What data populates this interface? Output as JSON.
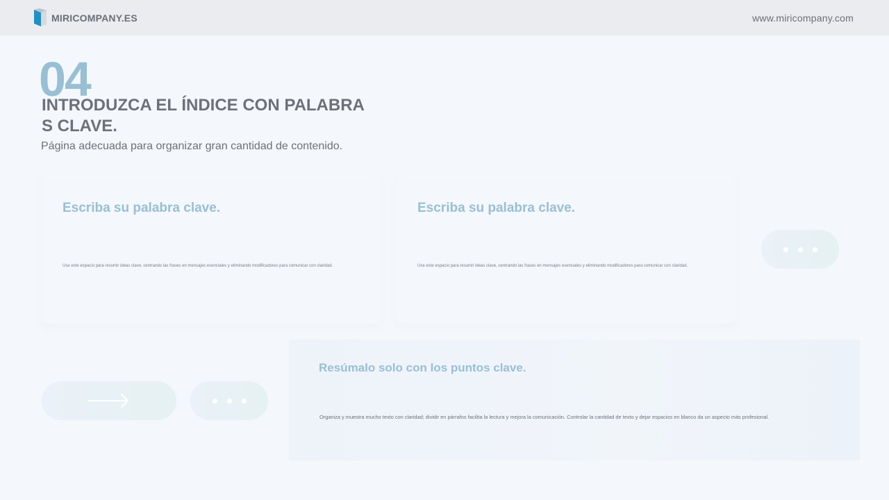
{
  "header": {
    "brand": "MIRICOMPANY.ES",
    "url": "www.miricompany.com",
    "logo_icon": "cube-logo-icon",
    "accent_color": "#1e90c8"
  },
  "intro": {
    "number": "04",
    "title": "INTRODUZCA EL ÍNDICE CON PALABRAS CLAVE.",
    "subtitle": "Página adecuada para organizar gran cantidad de contenido."
  },
  "cards": [
    {
      "title": "Escriba su palabra clave.",
      "body": "Use este espacio para resumir ideas clave, centrando las frases en mensajes esenciales y eliminando modificadores para comunicar con claridad."
    },
    {
      "title": "Escriba su palabra clave.",
      "body": "Use este espacio para resumir ideas clave, centrando las frases en mensajes esenciales y eliminando modificadores para comunicar con claridad."
    }
  ],
  "summary": {
    "title": "Resúmalo solo con los puntos clave.",
    "body": "Organiza y muestra mucho texto con claridad; dividir en párrafos facilita la lectura y mejora la comunicación. Controlar la cantidad de texto y dejar espacios en blanco da un aspecto más profesional."
  },
  "decorations": {
    "dots_icon": "ellipsis-icon",
    "arrow_icon": "arrow-right-icon",
    "title_color": "#98bfd4",
    "text_color": "#6d7079"
  }
}
